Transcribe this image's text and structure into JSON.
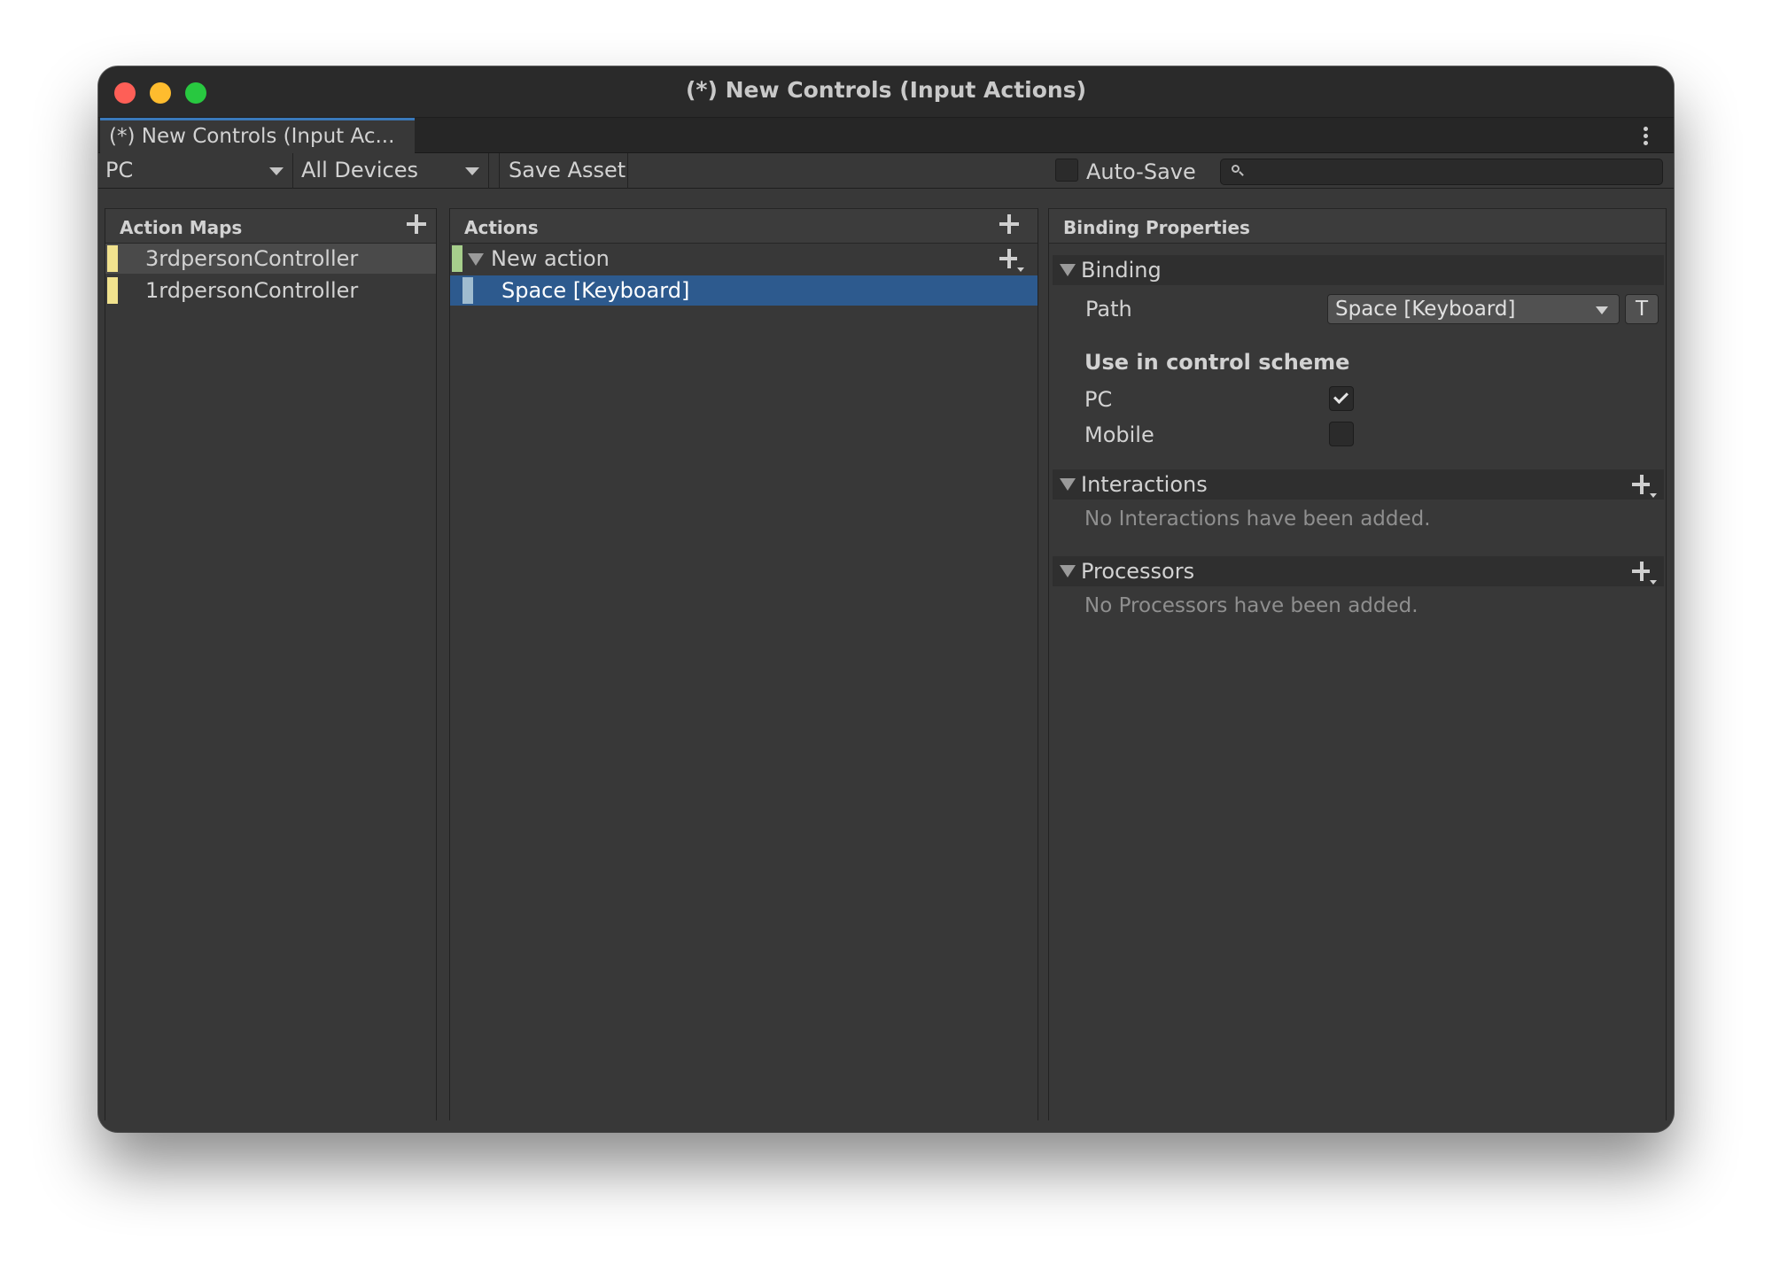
{
  "window": {
    "title": "(*) New Controls (Input Actions)"
  },
  "tab": {
    "label": "(*) New Controls (Input Ac..."
  },
  "toolbar": {
    "control_scheme": "PC",
    "devices": "All Devices",
    "save_label": "Save Asset",
    "autosave_label": "Auto-Save",
    "autosave_checked": false,
    "search_placeholder": ""
  },
  "action_maps": {
    "header": "Action Maps",
    "items": [
      {
        "label": "3rdpersonController",
        "selected": true
      },
      {
        "label": "1rdpersonController",
        "selected": false
      }
    ]
  },
  "actions": {
    "header": "Actions",
    "items": [
      {
        "label": "New action",
        "expanded": true
      },
      {
        "label": "Space [Keyboard]",
        "selected": true
      }
    ]
  },
  "binding_properties": {
    "header": "Binding Properties",
    "binding_section": "Binding",
    "path_label": "Path",
    "path_value": "Space [Keyboard]",
    "t_button": "T",
    "use_in_scheme_label": "Use in control scheme",
    "schemes": [
      {
        "label": "PC",
        "checked": true
      },
      {
        "label": "Mobile",
        "checked": false
      }
    ],
    "interactions_section": "Interactions",
    "interactions_empty": "No Interactions have been added.",
    "processors_section": "Processors",
    "processors_empty": "No Processors have been added."
  },
  "colors": {
    "window_bg": "#383838",
    "selection_blue": "#2d5a8e",
    "tab_accent": "#3a79bb",
    "map_strip": "#f1e28e",
    "action_strip": "#a7cf8c",
    "binding_strip": "#9fbcd0"
  }
}
